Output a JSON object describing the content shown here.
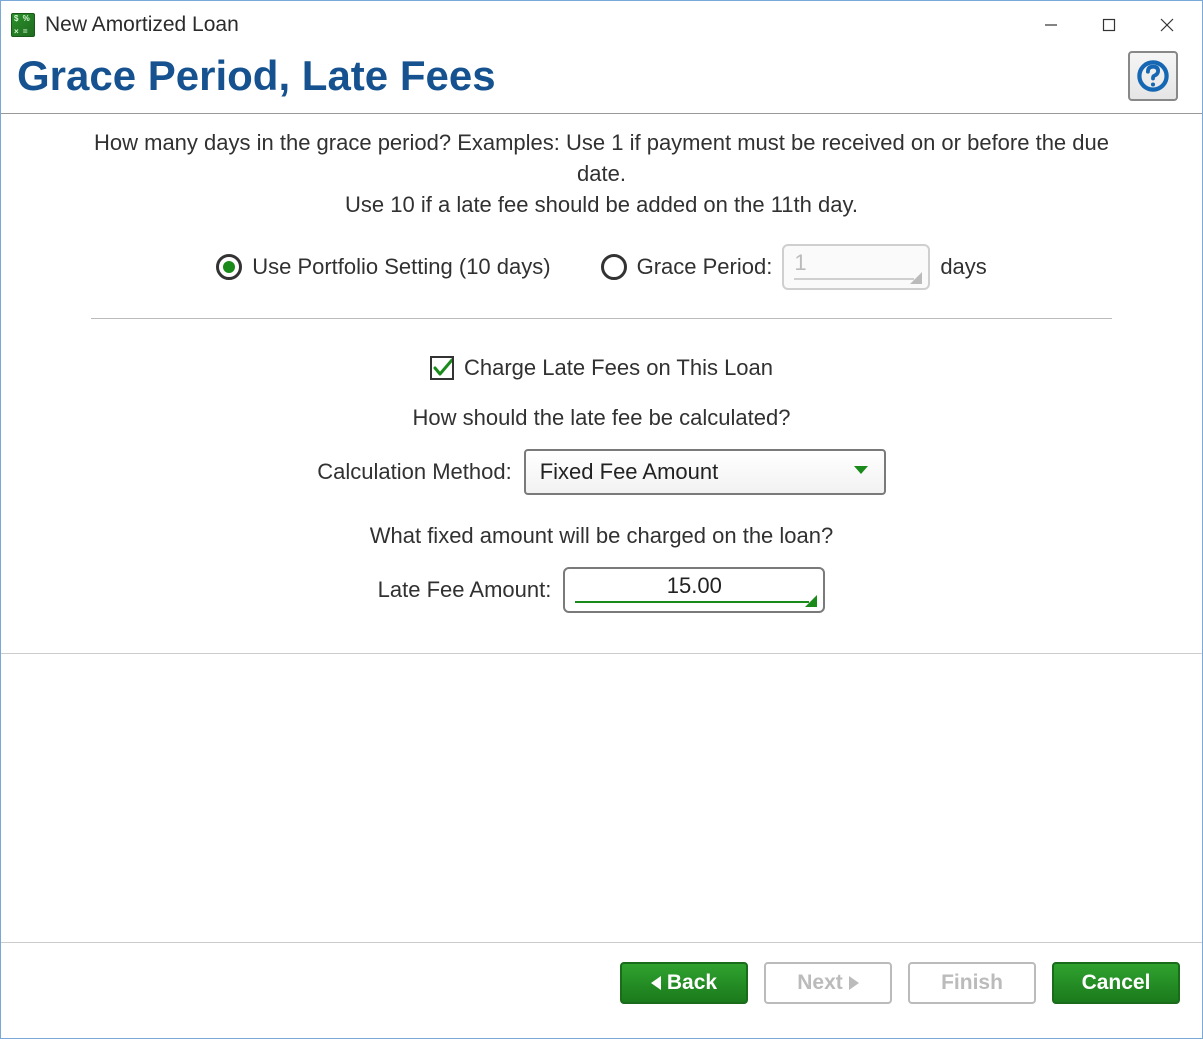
{
  "window": {
    "title": "New Amortized Loan"
  },
  "header": {
    "page_title": "Grace Period, Late Fees"
  },
  "intro": {
    "line1": "How many days in the grace period?  Examples: Use 1 if payment must be received on or before the due date.",
    "line2": "Use 10 if a late fee should be added on the 11th day."
  },
  "grace": {
    "use_portfolio_label": "Use Portfolio Setting (10 days)",
    "use_portfolio_selected": true,
    "custom_label": "Grace Period:",
    "custom_value": "1",
    "custom_suffix": "days",
    "custom_selected": false
  },
  "late_fees": {
    "charge_label": "Charge Late Fees on This Loan",
    "charge_checked": true,
    "how_question": "How should the late fee be calculated?",
    "calc_method_label": "Calculation Method:",
    "calc_method_value": "Fixed Fee Amount",
    "fixed_question": "What fixed amount will be charged on the loan?",
    "amount_label": "Late Fee Amount:",
    "amount_value": "15.00"
  },
  "buttons": {
    "back": "Back",
    "next": "Next",
    "finish": "Finish",
    "cancel": "Cancel"
  }
}
